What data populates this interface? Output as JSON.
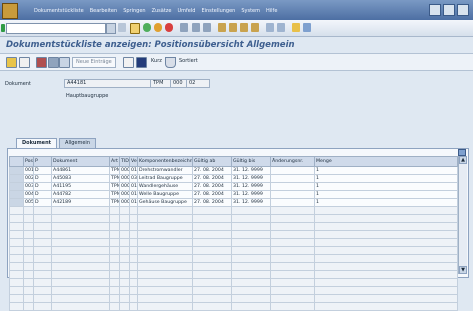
{
  "menu": {
    "items": [
      "Dokumentstückliste",
      "Bearbeiten",
      "Springen",
      "Zusätze",
      "Umfeld",
      "Einstellungen",
      "System",
      "Hilfe"
    ]
  },
  "title": "Dokumentstückliste anzeigen: Positionsübersicht Allgemein",
  "toolbar": {
    "new_entries": "Neue Einträge",
    "short": "Kurz",
    "sorted": "Sortiert"
  },
  "header": {
    "document_label": "Dokument",
    "document_number": "A44181",
    "document_type": "TPM",
    "document_part": "000",
    "document_version": "02",
    "description": "Hauptbaugruppe"
  },
  "tabs": [
    "Dokument",
    "Allgemein"
  ],
  "table": {
    "columns": [
      "Pos.",
      "P",
      "Dokument",
      "Art",
      "TID",
      "Ve",
      "Komponentenbezeichn.",
      "Gültig ab",
      "Gültig bis",
      "Änderungsnr.",
      "Menge"
    ],
    "rows": [
      [
        "0010",
        "D",
        "A44861",
        "TPM",
        "000",
        "01",
        "Drehstromwandler",
        "27. 08. 2004",
        "31. 12. 9999",
        "",
        "1"
      ],
      [
        "0020",
        "D",
        "A45083",
        "TPM",
        "000",
        "03",
        "Leitrad Baugruppe",
        "27. 08. 2004",
        "31. 12. 9999",
        "",
        "1"
      ],
      [
        "0030",
        "D",
        "A41195",
        "TPM",
        "000",
        "01",
        "Wandlergehäuse",
        "27. 08. 2004",
        "31. 12. 9999",
        "",
        "1"
      ],
      [
        "0040",
        "D",
        "A44782",
        "TPM",
        "000",
        "01",
        "Welle Baugruppe",
        "27. 08. 2004",
        "31. 12. 9999",
        "",
        "1"
      ],
      [
        "0050",
        "D",
        "A42189",
        "TPM",
        "000",
        "01",
        "Gehäuse Baugruppe",
        "27. 08. 2004",
        "31. 12. 9999",
        "",
        "1"
      ]
    ],
    "empty_rows": 13
  }
}
